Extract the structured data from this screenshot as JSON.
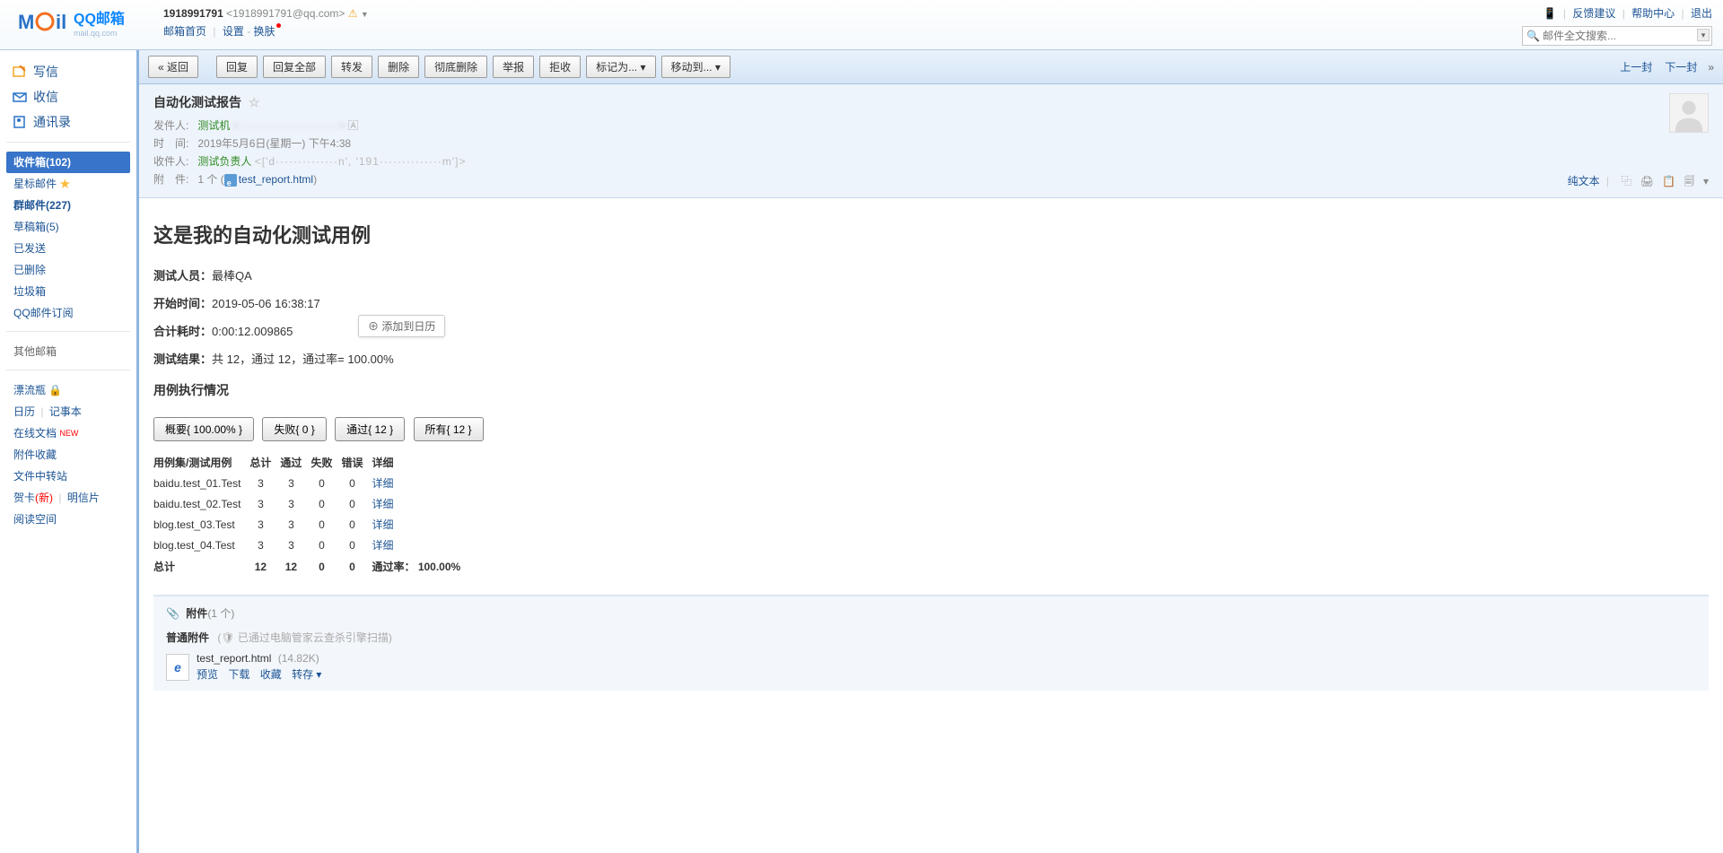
{
  "header": {
    "brand": "QQ邮箱",
    "brand_sub": "mail.qq.com",
    "account_number": "1918991791",
    "account_email": "<1918991791@qq.com>",
    "links": {
      "home": "邮箱首页",
      "settings": "设置",
      "skin": "换肤"
    },
    "top_right": {
      "mobile": "📱",
      "feedback": "反馈建议",
      "help": "帮助中心",
      "logout": "退出"
    },
    "search_placeholder": "邮件全文搜索..."
  },
  "sidebar": {
    "main": {
      "compose": "写信",
      "receive": "收信",
      "contacts": "通讯录"
    },
    "folders": [
      {
        "key": "inbox",
        "label": "收件箱(102)",
        "active": true,
        "bold": true
      },
      {
        "key": "star",
        "label": "星标邮件 ",
        "star": true
      },
      {
        "key": "group",
        "label": "群邮件(227)",
        "bold": true
      },
      {
        "key": "drafts",
        "label": "草稿箱(5)"
      },
      {
        "key": "sent",
        "label": "已发送"
      },
      {
        "key": "deleted",
        "label": "已删除"
      },
      {
        "key": "spam",
        "label": "垃圾箱"
      },
      {
        "key": "sub",
        "label": "QQ邮件订阅"
      }
    ],
    "other_label": "其他邮箱",
    "extras": {
      "bottle": "漂流瓶 🔒",
      "calendar": "日历",
      "notes": "记事本",
      "docs": "在线文档",
      "docs_new": "NEW",
      "attach_fav": "附件收藏",
      "file_transfer": "文件中转站",
      "card": "贺卡",
      "card_new": "(新)",
      "postcard": "明信片",
      "readspace": "阅读空间"
    }
  },
  "toolbar": {
    "back": "« 返回",
    "buttons": [
      "回复",
      "回复全部",
      "转发",
      "删除",
      "彻底删除",
      "举报",
      "拒收",
      "标记为...  ▾",
      "移动到...  ▾"
    ],
    "prev": "上一封",
    "next": "下一封"
  },
  "mail": {
    "subject": "自动化测试报告",
    "star": "☆",
    "sender_label": "发件人:",
    "sender_name": "测试机",
    "sender_addr_masked": "< ·························· >",
    "time_label": "时　间:",
    "time": "2019年5月6日(星期一) 下午4:38",
    "recipient_label": "收件人:",
    "recipient_name": "测试负责人",
    "recipient_addr_masked": "<['d··············n', '191··············m']>",
    "attach_label": "附　件:",
    "attach_count": "1 个",
    "attach_name": "test_report.html",
    "tools": {
      "plaintext": "纯文本",
      "icons": [
        "⿻",
        "🖨",
        "📋",
        "🗐"
      ],
      "drop": "▾"
    }
  },
  "body": {
    "title": "这是我的自动化测试用例",
    "tester_label": "测试人员：",
    "tester": "最棒QA",
    "start_label": "开始时间：",
    "start": "2019-05-06 16:38:17",
    "elapsed_label": "合计耗时：",
    "elapsed": "0:00:12.009865",
    "result_label": "测试结果：",
    "result": "共 12，通过 12，通过率= 100.00%",
    "calendar_hint": "⊕ 添加到日历",
    "section": "用例执行情况",
    "btns": [
      "概要{ 100.00% }",
      "失败{ 0 }",
      "通过{ 12 }",
      "所有{ 12 }"
    ],
    "table": {
      "headers": [
        "用例集/测试用例",
        "总计",
        "通过",
        "失败",
        "错误",
        "详细"
      ],
      "rows": [
        {
          "name": "baidu.test_01.Test",
          "total": 3,
          "pass": 3,
          "fail": 0,
          "error": 0,
          "link": "详细"
        },
        {
          "name": "baidu.test_02.Test",
          "total": 3,
          "pass": 3,
          "fail": 0,
          "error": 0,
          "link": "详细"
        },
        {
          "name": "blog.test_03.Test",
          "total": 3,
          "pass": 3,
          "fail": 0,
          "error": 0,
          "link": "详细"
        },
        {
          "name": "blog.test_04.Test",
          "total": 3,
          "pass": 3,
          "fail": 0,
          "error": 0,
          "link": "详细"
        }
      ],
      "footer": {
        "label": "总计",
        "total": 12,
        "pass": 12,
        "fail": 0,
        "error": 0,
        "rate_label": "通过率：",
        "rate": "100.00%"
      }
    }
  },
  "attach": {
    "title": "附件",
    "count": "(1 个)",
    "normal_label": "普通附件",
    "scan_info": "(🛡 已通过电脑管家云查杀引擎扫描)",
    "file_name": "test_report.html",
    "file_size": "(14.82K)",
    "actions": {
      "preview": "预览",
      "download": "下载",
      "favorite": "收藏",
      "transfer": "转存 ▾"
    }
  }
}
